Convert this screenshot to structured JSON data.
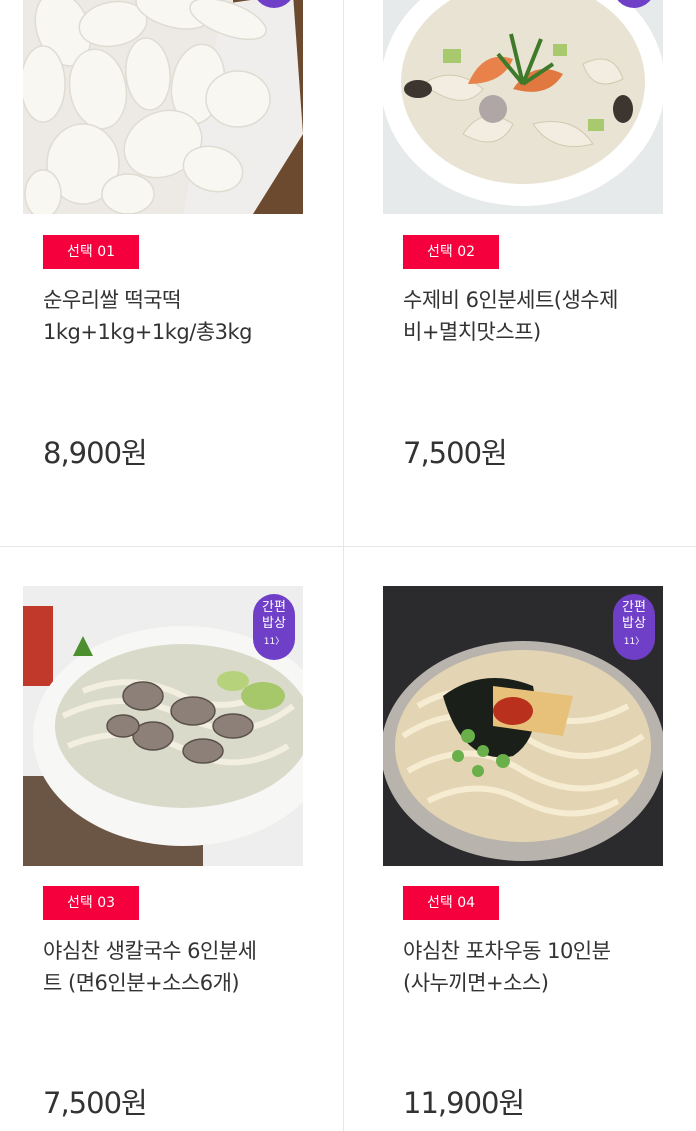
{
  "products": [
    {
      "tag": "선택 01",
      "name_line1": "순우리쌀 떡국떡",
      "name_line2": "1kg+1kg+1kg/총3kg",
      "price": "8,900원"
    },
    {
      "tag": "선택 02",
      "name_line1": "수제비 6인분세트(생수제",
      "name_line2": "비+멸치맛스프)",
      "price": "7,500원"
    },
    {
      "tag": "선택 03",
      "name_line1": "야심찬 생칼국수 6인분세",
      "name_line2": "트 (면6인분+소스6개)",
      "price": "7,500원"
    },
    {
      "tag": "선택 04",
      "name_line1": "야심찬 포차우동 10인분",
      "name_line2": "(사누끼면+소스)",
      "price": "11,900원"
    }
  ],
  "badge": {
    "line1": "간편",
    "line2": "밥상",
    "line3": "11〉"
  },
  "colors": {
    "tag_bg": "#f5003d",
    "badge_bg": "#6f3fc7"
  }
}
